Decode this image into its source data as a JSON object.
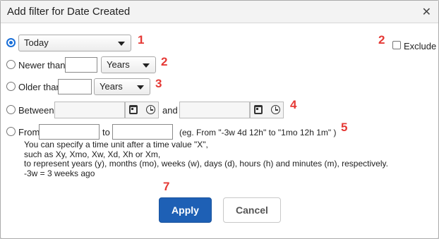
{
  "dialog": {
    "title": "Add filter for Date Created",
    "close_icon": "close-icon"
  },
  "options": {
    "today": {
      "select_value": "Today",
      "selected": true
    },
    "newer": {
      "label": "Newer than",
      "value": "",
      "unit": "Years"
    },
    "older": {
      "label": "Older than",
      "value": "",
      "unit": "Years"
    },
    "between": {
      "label": "Between",
      "and_label": "and",
      "start": "",
      "end": ""
    },
    "from": {
      "label": "From",
      "to_label": "to",
      "start": "",
      "end": "",
      "example": "(eg. From \"-3w 4d 12h\" to \"1mo 12h 1m\" )"
    }
  },
  "exclude": {
    "label": "Exclude",
    "checked": false
  },
  "help_lines": [
    "You can specify a time unit after a time value \"X\",",
    "such as Xy, Xmo, Xw, Xd, Xh or Xm,",
    "to represent years (y), months (mo), weeks (w), days (d), hours (h) and minutes (m), respectively.",
    "-3w = 3 weeks ago"
  ],
  "annotations": [
    "1",
    "2",
    "2",
    "3",
    "4",
    "5",
    "7"
  ],
  "buttons": {
    "apply": "Apply",
    "cancel": "Cancel"
  },
  "colors": {
    "primary": "#1e60b5",
    "annotation": "#e53935",
    "radio_selected": "#1a6fd8"
  }
}
